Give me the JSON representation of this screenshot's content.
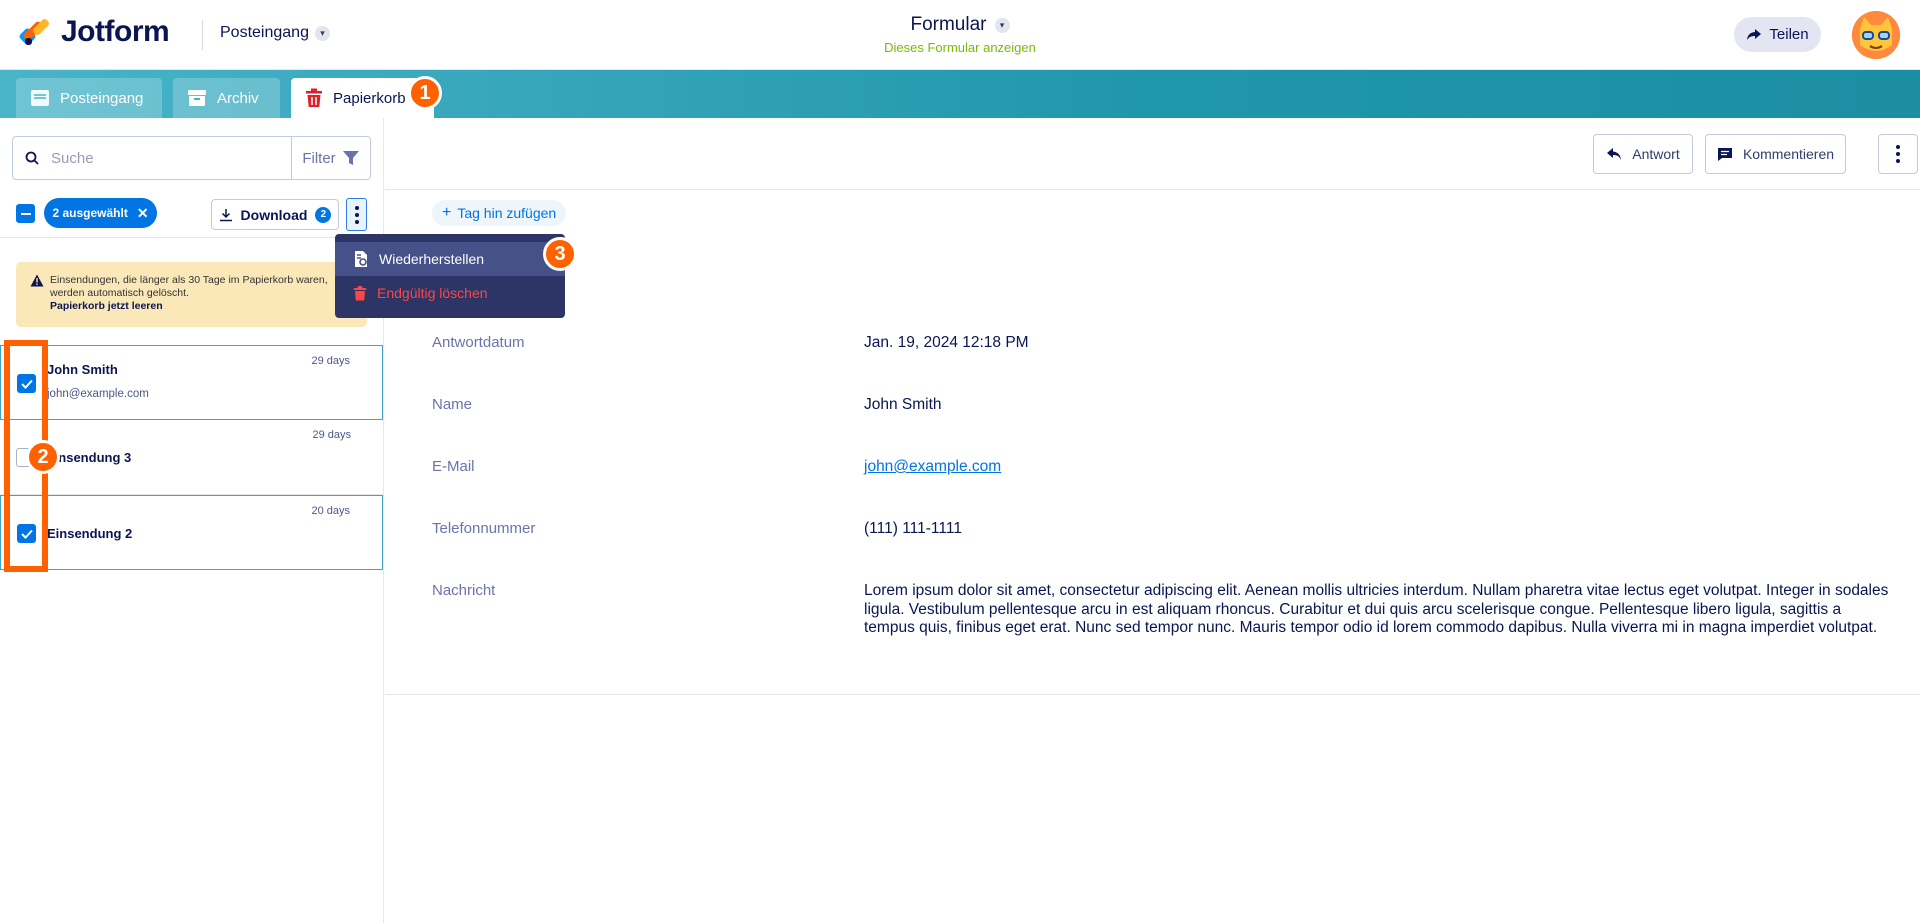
{
  "header": {
    "logo_text": "Jotform",
    "inbox_switch_label": "Posteingang",
    "form_title": "Formular",
    "form_subtitle": "Dieses Formular anzeigen",
    "share_label": "Teilen"
  },
  "tabs": [
    {
      "label": "Posteingang",
      "icon": "inbox-icon"
    },
    {
      "label": "Archiv",
      "icon": "archive-icon"
    },
    {
      "label": "Papierkorb",
      "icon": "trash-icon",
      "active": true
    }
  ],
  "sidebar": {
    "search_placeholder": "Suche",
    "filter_label": "Filter",
    "selected_pill": "2 ausgewählt",
    "download_label": "Download",
    "download_count": "2",
    "warning_text": "Einsendungen, die länger als 30 Tage im Papierkorb waren, werden automatisch gelöscht.",
    "warning_link": "Papierkorb jetzt leeren",
    "submissions": [
      {
        "title": "John Smith",
        "email": "john@example.com",
        "age": "29 days",
        "checked": true
      },
      {
        "title": "Einsendung 3",
        "email": "",
        "age": "29 days",
        "checked": false
      },
      {
        "title": "Einsendung 2",
        "email": "",
        "age": "20 days",
        "checked": true
      }
    ]
  },
  "context_menu": {
    "restore_label": "Wiederherstellen",
    "delete_label": "Endgültig löschen"
  },
  "detail": {
    "reply_label": "Antwort",
    "comment_label": "Kommentieren",
    "add_tag_label": "Tag hin zufügen",
    "fields": [
      {
        "label": "Antwortdatum",
        "value": "Jan. 19, 2024 12:18 PM"
      },
      {
        "label": "Name",
        "value": "John Smith"
      },
      {
        "label": "E-Mail",
        "value": "john@example.com"
      },
      {
        "label": "Telefonnummer",
        "value": "(111) 111-1111"
      },
      {
        "label": "Nachricht",
        "value": "Lorem ipsum dolor sit amet, consectetur adipiscing elit. Aenean mollis ultricies interdum. Nullam pharetra vitae lectus eget volutpat. Integer in sodales ligula. Vestibulum pellentesque arcu in est aliquam rhoncus. Curabitur et dui quis arcu scelerisque congue. Pellentesque libero ligula, sagittis a tempus quis, finibus eget erat. Nunc sed tempor nunc. Mauris tempor odio id lorem commodo dapibus. Nulla viverra mi in magna imperdiet volutpat."
      }
    ]
  },
  "annotations": {
    "badge_1": "1",
    "badge_2": "2",
    "badge_3": "3"
  },
  "colors": {
    "accent": "#0075e3",
    "annotation": "#ff6100",
    "tabbar": "#2096ac",
    "menu_bg": "#2c3565",
    "danger": "#ff4646"
  }
}
